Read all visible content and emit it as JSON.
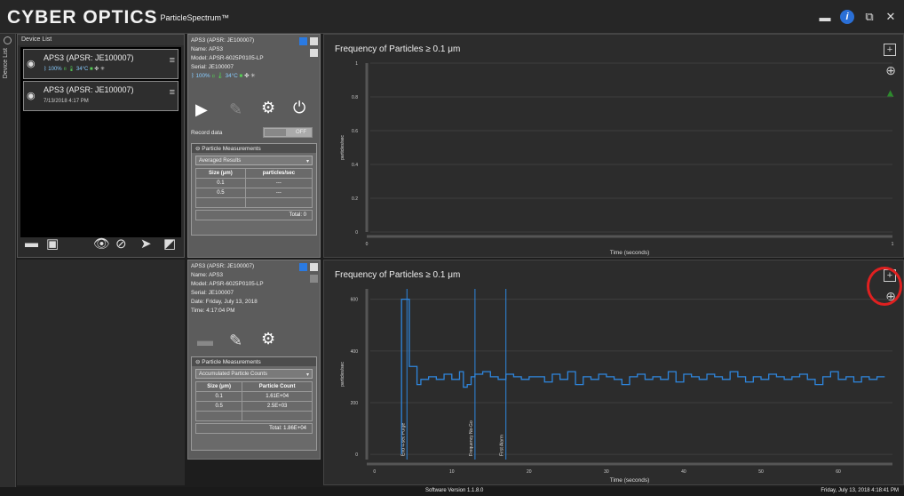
{
  "app": {
    "logo": "CYBER OPTICS",
    "product": "ParticleSpectrum™"
  },
  "window_buttons": [
    "folder-icon",
    "info-icon",
    "restore-icon",
    "close-icon"
  ],
  "sidebar": {
    "tab_label": "Device List"
  },
  "device_list": {
    "header": "Device List",
    "devices": [
      {
        "name": "APS3 (APSR: JE100007)",
        "battery": "100%",
        "temp": "34°C"
      },
      {
        "name": "APS3 (APSR: JE100007)",
        "date": "7/13/2018  4:17 PM"
      }
    ]
  },
  "panel1": {
    "title": "APS3 (APSR: JE100007)",
    "name": "Name:  APS3",
    "model": "Model: APSR-6025P0105-LP",
    "serial": "Serial:  JE100007",
    "battery": "100%",
    "temp": "34°C",
    "record_label": "Record data",
    "record_state": "OFF",
    "pm_title": "Particle Measurements",
    "mode": "Averaged Results",
    "cols": [
      "Size (μm)",
      "particles/sec"
    ],
    "rows": [
      [
        "0.1",
        "---"
      ],
      [
        "0.5",
        "---"
      ]
    ],
    "total": "Total:   0"
  },
  "panel2": {
    "title": "APS3 (APSR: JE100007)",
    "name": "Name:  APS3",
    "model": "Model: APSR-6025P0105-LP",
    "serial": "Serial:  JE100007",
    "date": "Date:  Friday, July 13, 2018",
    "time": "Time:  4:17:04 PM",
    "pm_title": "Particle Measurements",
    "mode": "Accumulated Particle Counts",
    "cols": [
      "Size (μm)",
      "Particle Count"
    ],
    "rows": [
      [
        "0.1",
        "1.61E+04"
      ],
      [
        "0.5",
        "2.5E+03"
      ]
    ],
    "total": "Total: 1.86E+04"
  },
  "chart_data": [
    {
      "type": "line",
      "title": "Frequency of Particles ≥ 0.1 μm",
      "xlabel": "Time (seconds)",
      "ylabel": "particles/sec",
      "xlim": [
        0,
        1
      ],
      "ylim": [
        0,
        1
      ],
      "yticks": [
        "0",
        "0.2",
        "0.4",
        "0.6",
        "0.8",
        "1"
      ],
      "xticks": [
        "0",
        "1"
      ],
      "series": [],
      "grid": true
    },
    {
      "type": "line",
      "title": "Frequency of Particles ≥ 0.1 μm",
      "xlabel": "Time (seconds)",
      "ylabel": "particles/sec",
      "xlim": [
        -1,
        67
      ],
      "ylim": [
        -20,
        640
      ],
      "yticks": [
        "0",
        "200",
        "400",
        "600"
      ],
      "xticks": [
        "0",
        "10",
        "20",
        "30",
        "40",
        "50",
        "60"
      ],
      "grid": true,
      "color": "#2e86de",
      "markers": [
        {
          "x": 4.2,
          "label": "End 4-sec Purge"
        },
        {
          "x": 13,
          "label": "Frequency No-Go"
        },
        {
          "x": 17,
          "label": "First Alarm"
        }
      ],
      "x": [
        3.5,
        4.5,
        5.5,
        6,
        7,
        8,
        9,
        10,
        11,
        11.5,
        12,
        12.5,
        13,
        14,
        15,
        16,
        17,
        18,
        19,
        20,
        21,
        22,
        23,
        24,
        25,
        26,
        27,
        28,
        29,
        30,
        31,
        32,
        33,
        34,
        35,
        36,
        37,
        38,
        39,
        40,
        41,
        42,
        43,
        44,
        45,
        46,
        47,
        48,
        49,
        50,
        51,
        52,
        53,
        54,
        55,
        56,
        57,
        58,
        59,
        60,
        61,
        62,
        63,
        64,
        65
      ],
      "values": [
        600,
        340,
        270,
        290,
        300,
        290,
        310,
        290,
        320,
        260,
        270,
        300,
        310,
        320,
        300,
        290,
        310,
        300,
        290,
        300,
        300,
        280,
        310,
        290,
        320,
        270,
        300,
        290,
        310,
        300,
        290,
        270,
        300,
        310,
        290,
        300,
        290,
        320,
        280,
        310,
        300,
        290,
        310,
        300,
        290,
        320,
        300,
        280,
        300,
        290,
        310,
        300,
        290,
        300,
        310,
        290,
        270,
        300,
        320,
        290,
        300,
        280,
        300,
        290,
        300
      ]
    }
  ],
  "status": {
    "version": "Software Version  1.1.8.0",
    "datetime": "Friday, July 13, 2018    4:18:41 PM"
  }
}
